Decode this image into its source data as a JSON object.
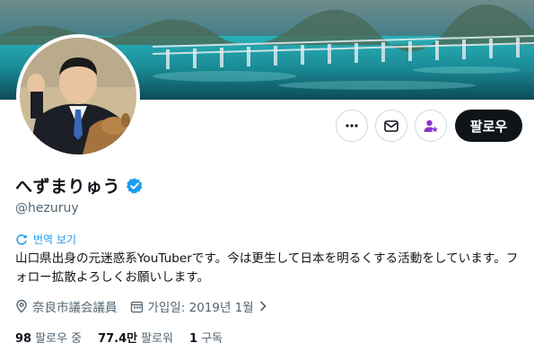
{
  "profile": {
    "display_name": "へずまりゅう",
    "handle": "@hezuruy",
    "translate_label": "번역 보기",
    "bio": "山口県出身の元迷惑系YouTuberです。今は更生して日本を明るくする活動をしています。フォロー拡散よろしくお願いします。",
    "location": "奈良市議会議員",
    "joined": "가입일: 2019년 1월"
  },
  "stats": {
    "following_count": "98",
    "following_label": "팔로우 중",
    "followers_count": "77.4만",
    "followers_label": "팔로워",
    "subscriptions_count": "1",
    "subscriptions_label": "구독"
  },
  "actions": {
    "follow_label": "팔로우"
  },
  "colors": {
    "accent": "#1d9bf0",
    "subscribe_purple": "#8c36c8",
    "button_dark": "#0f1419"
  },
  "icons": [
    "more-icon",
    "message-icon",
    "subscribe-icon",
    "verified-icon",
    "translate-icon",
    "location-icon",
    "calendar-icon",
    "chevron-right-icon"
  ]
}
